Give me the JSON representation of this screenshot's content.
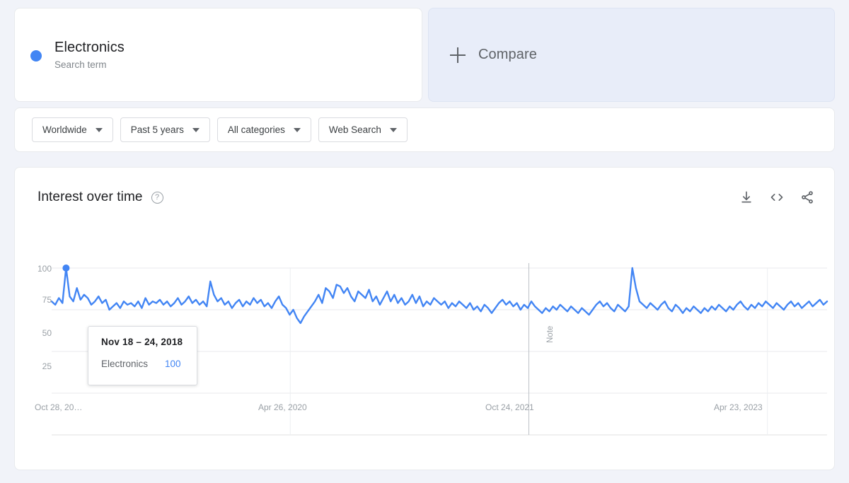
{
  "search_terms": [
    {
      "label": "Electronics",
      "sublabel": "Search term",
      "color": "#4285f4"
    }
  ],
  "compare": {
    "label": "Compare",
    "icon": "plus-icon"
  },
  "filters": [
    {
      "name": "location",
      "label": "Worldwide"
    },
    {
      "name": "time-range",
      "label": "Past 5 years"
    },
    {
      "name": "category",
      "label": "All categories"
    },
    {
      "name": "search-type",
      "label": "Web Search"
    }
  ],
  "chart_panel": {
    "title": "Interest over time",
    "help_icon": "help-circle-icon",
    "actions": [
      {
        "name": "download-csv",
        "icon": "download-icon"
      },
      {
        "name": "embed-code",
        "icon": "code-icon"
      },
      {
        "name": "share",
        "icon": "share-icon"
      }
    ]
  },
  "tooltip": {
    "date": "Nov 18 – 24, 2018",
    "series_name": "Electronics",
    "value": "100"
  },
  "annotation": {
    "label": "Note",
    "x_position": 758
  },
  "chart_data": {
    "type": "line",
    "title": "Interest over time",
    "xlabel": "",
    "ylabel": "",
    "ylim": [
      0,
      100
    ],
    "yticks": [
      100,
      75,
      50,
      25
    ],
    "ytick_labels": [
      "100",
      "75",
      "50",
      "25"
    ],
    "xtick_labels": [
      "Oct 28, 20…",
      "Apr 26, 2020",
      "Oct 24, 2021",
      "Apr 23, 2023"
    ],
    "xtick_positions": [
      0,
      0.3077,
      0.6154,
      0.9231
    ],
    "grid": true,
    "legend": "none",
    "line_color": "#4285f4",
    "series": [
      {
        "name": "Electronics",
        "color": "#4285f4",
        "values": [
          80,
          78,
          82,
          79,
          100,
          83,
          80,
          88,
          81,
          84,
          82,
          78,
          80,
          83,
          79,
          81,
          75,
          77,
          79,
          76,
          80,
          78,
          79,
          77,
          80,
          76,
          82,
          78,
          80,
          79,
          81,
          78,
          80,
          77,
          79,
          82,
          78,
          80,
          83,
          79,
          81,
          78,
          80,
          77,
          92,
          84,
          80,
          82,
          78,
          80,
          76,
          79,
          81,
          77,
          80,
          78,
          82,
          79,
          81,
          77,
          79,
          76,
          80,
          83,
          78,
          76,
          72,
          75,
          70,
          67,
          71,
          74,
          77,
          80,
          84,
          79,
          88,
          86,
          82,
          90,
          89,
          85,
          88,
          83,
          80,
          86,
          84,
          82,
          87,
          80,
          83,
          78,
          82,
          86,
          80,
          84,
          79,
          82,
          78,
          80,
          84,
          79,
          83,
          77,
          80,
          78,
          82,
          80,
          78,
          80,
          76,
          79,
          77,
          80,
          78,
          76,
          79,
          75,
          77,
          74,
          78,
          76,
          73,
          76,
          79,
          81,
          78,
          80,
          77,
          79,
          75,
          78,
          76,
          80,
          77,
          75,
          73,
          76,
          74,
          77,
          75,
          78,
          76,
          74,
          77,
          75,
          73,
          76,
          74,
          72,
          75,
          78,
          80,
          77,
          79,
          76,
          74,
          78,
          76,
          74,
          77,
          100,
          88,
          80,
          78,
          76,
          79,
          77,
          75,
          78,
          80,
          76,
          74,
          78,
          76,
          73,
          76,
          74,
          77,
          75,
          73,
          76,
          74,
          77,
          75,
          78,
          76,
          74,
          77,
          75,
          78,
          80,
          77,
          75,
          78,
          76,
          79,
          77,
          80,
          78,
          76,
          79,
          77,
          75,
          78,
          80,
          77,
          79,
          76,
          78,
          80,
          77,
          79,
          81,
          78,
          80
        ]
      }
    ],
    "annotations": [
      {
        "label": "Note",
        "type": "vertical-line",
        "x_fraction": 0.6154
      }
    ],
    "highlight_point": {
      "label": "Nov 18 – 24, 2018",
      "series": "Electronics",
      "value": 100
    }
  }
}
